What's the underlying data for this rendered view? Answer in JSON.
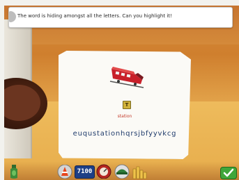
{
  "banner": {
    "instruction": "The word is hiding amongst all the letters. Can you highlight it!"
  },
  "card": {
    "word": "station",
    "letters": "euqustationhqrsjbfyyvkcg",
    "tile_glyph": "T"
  },
  "toolbar": {
    "clock_text": "7100"
  },
  "colors": {
    "word": "#c43a2a",
    "letters": "#1e3a6b",
    "accent_green": "#3fa63a"
  },
  "icons": {
    "speaker": "speaker-icon",
    "train": "train-icon",
    "tile": "letter-tile-icon",
    "bottle": "bottle-icon",
    "cone": "traffic-cone-icon",
    "clock": "digital-clock-icon",
    "gauge": "gauge-icon",
    "cap": "cap-icon",
    "bars": "bar-chart-icon",
    "ok": "check-icon"
  }
}
